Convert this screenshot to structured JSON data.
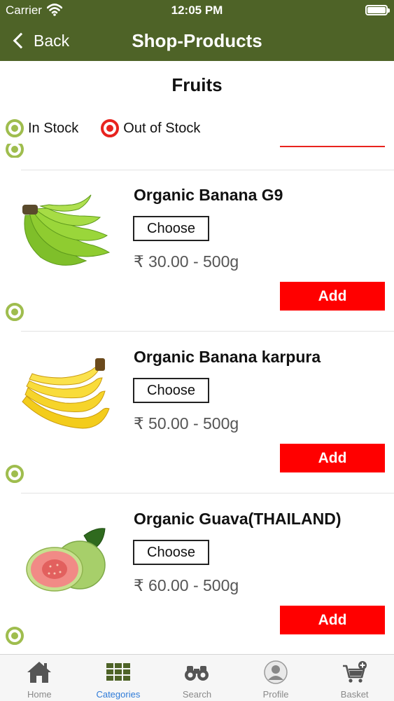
{
  "status": {
    "carrier": "Carrier",
    "time": "12:05 PM"
  },
  "nav": {
    "back_label": "Back",
    "title": "Shop-Products"
  },
  "category": {
    "title": "Fruits"
  },
  "legend": {
    "in_stock": "In Stock",
    "out_of_stock": "Out of Stock"
  },
  "colors": {
    "header": "#4e6327",
    "in_stock": "#9fbd4e",
    "out_of_stock": "#e8231e",
    "add_button": "#ff0000",
    "active_tab": "#2f7bd8"
  },
  "products": [
    {
      "name": "Organic Banana G9",
      "choose_label": "Choose",
      "price": "₹ 30.00 - 500g",
      "add_label": "Add",
      "image": "green-banana-image",
      "stock": "in_stock"
    },
    {
      "name": "Organic Banana karpura",
      "choose_label": "Choose",
      "price": "₹ 50.00 - 500g",
      "add_label": "Add",
      "image": "yellow-banana-image",
      "stock": "in_stock"
    },
    {
      "name": "Organic Guava(THAILAND)",
      "choose_label": "Choose",
      "price": "₹ 60.00 - 500g",
      "add_label": "Add",
      "image": "guava-image",
      "stock": "in_stock"
    }
  ],
  "tabs": [
    {
      "label": "Home",
      "icon": "home-icon",
      "active": false
    },
    {
      "label": "Categories",
      "icon": "grid-icon",
      "active": true
    },
    {
      "label": "Search",
      "icon": "binoculars-icon",
      "active": false
    },
    {
      "label": "Profile",
      "icon": "profile-icon",
      "active": false
    },
    {
      "label": "Basket",
      "icon": "cart-add-icon",
      "active": false
    }
  ]
}
